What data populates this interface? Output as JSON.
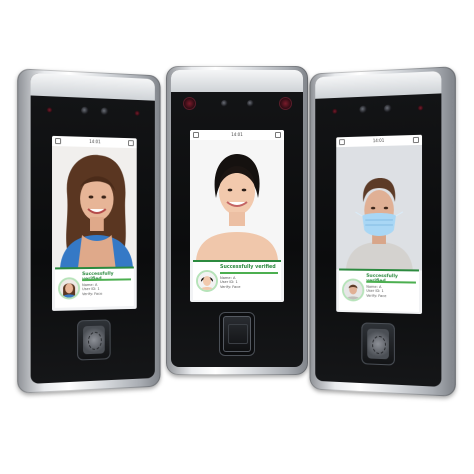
{
  "devices": [
    {
      "id": "left",
      "time": "14:01",
      "verified_text": "Successfully verified",
      "info_lines": [
        "Name: A",
        "User ID: 1",
        "Verify: Face"
      ],
      "subject": "woman-brown-hair"
    },
    {
      "id": "middle",
      "time": "14:01",
      "verified_text": "Successfully verified",
      "info_lines": [
        "Name: A",
        "User ID: 1",
        "Verify: Face"
      ],
      "subject": "woman-black-hair"
    },
    {
      "id": "right",
      "time": "14:01",
      "verified_text": "Successfully verified",
      "info_lines": [
        "Name: A",
        "User ID: 1",
        "Verify: Face"
      ],
      "subject": "man-with-mask"
    }
  ],
  "colors": {
    "verified_green": "#2c8a3f",
    "mask_blue": "#9ecff2",
    "screen_bg": "#f2f3f5"
  },
  "icons": [
    "camera-icon",
    "infrared-led-icon",
    "fingerprint-sensor-icon",
    "back-arrow-icon",
    "settings-icon"
  ]
}
